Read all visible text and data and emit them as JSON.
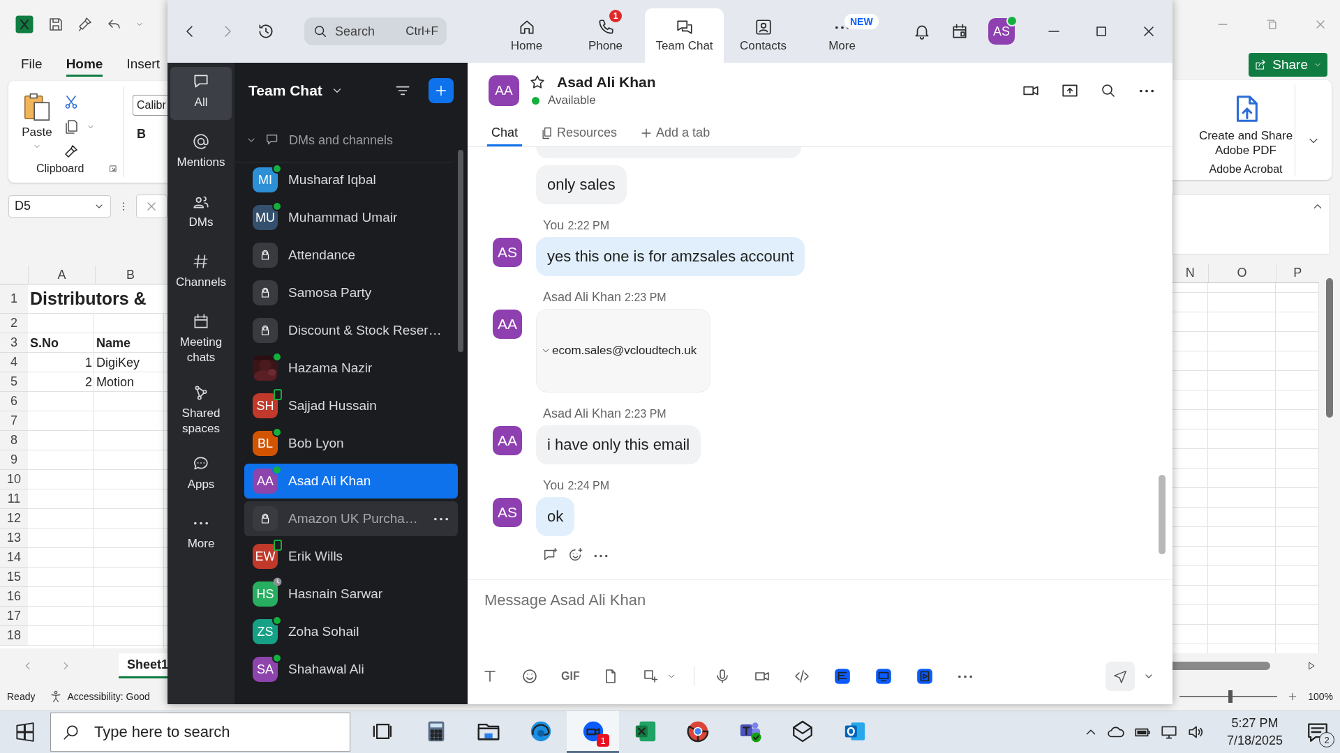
{
  "excel": {
    "ribbon_tabs": [
      {
        "label": "File",
        "selected": false
      },
      {
        "label": "Home",
        "selected": true
      },
      {
        "label": "Insert",
        "selected": false
      }
    ],
    "paste_label": "Paste",
    "clipboard_label": "Clipboard",
    "font_name": "Calibr",
    "bold_label": "B",
    "name_box": "D5",
    "left_columns": [
      "A",
      "B"
    ],
    "rows": [
      {
        "number": "1",
        "kind": "title",
        "text": "Distributors &"
      },
      {
        "number": "2",
        "kind": "plain"
      },
      {
        "number": "3",
        "kind": "header",
        "a": "S.No",
        "b": "Name"
      },
      {
        "number": "4",
        "kind": "plain",
        "a": "1",
        "b": "DigiKey"
      },
      {
        "number": "5",
        "kind": "plain",
        "a": "2",
        "b": "Motion"
      },
      {
        "number": "6",
        "kind": "plain"
      },
      {
        "number": "7",
        "kind": "plain"
      },
      {
        "number": "8",
        "kind": "plain"
      },
      {
        "number": "9",
        "kind": "plain"
      },
      {
        "number": "10",
        "kind": "plain"
      },
      {
        "number": "11",
        "kind": "plain"
      },
      {
        "number": "12",
        "kind": "plain"
      },
      {
        "number": "13",
        "kind": "plain"
      },
      {
        "number": "14",
        "kind": "plain"
      },
      {
        "number": "15",
        "kind": "plain"
      },
      {
        "number": "16",
        "kind": "plain"
      },
      {
        "number": "17",
        "kind": "plain"
      },
      {
        "number": "18",
        "kind": "plain"
      }
    ],
    "share_label": "Share",
    "acrobat_button": "Create and Share Adobe PDF",
    "acrobat_group": "Adobe Acrobat",
    "right_columns": [
      "N",
      "O",
      "P"
    ],
    "sheet_tab": "Sheet1",
    "status": "Ready",
    "accessibility": "Accessibility: Good",
    "zoom_slider": {
      "level": 0.52
    },
    "zoom_level": "100%"
  },
  "zoom": {
    "search": {
      "placeholder": "Search",
      "shortcut": "Ctrl+F"
    },
    "nav": [
      {
        "label": "Home",
        "kind": "home",
        "selected": false
      },
      {
        "label": "Phone",
        "kind": "phone",
        "selected": false,
        "badge": "1",
        "badge_new": false
      },
      {
        "label": "Team Chat",
        "kind": "chat",
        "selected": true
      },
      {
        "label": "Contacts",
        "kind": "contacts",
        "selected": false
      },
      {
        "label": "More",
        "kind": "more",
        "selected": false,
        "badge": "NEW",
        "badge_new": true
      }
    ],
    "user_avatar": {
      "initials": "AS",
      "online": true
    },
    "rail": [
      {
        "label": "All",
        "kind": "all",
        "selected": true
      },
      {
        "label": "Mentions",
        "kind": "mentions",
        "selected": false
      },
      {
        "label": "DMs",
        "kind": "dms",
        "selected": false
      },
      {
        "label": "Channels",
        "kind": "channels",
        "selected": false
      },
      {
        "label": "Meeting chats",
        "kind": "meetings",
        "selected": false
      },
      {
        "label": "Shared spaces",
        "kind": "spaces",
        "selected": false
      },
      {
        "label": "Apps",
        "kind": "apps",
        "selected": false
      },
      {
        "label": "More",
        "kind": "more",
        "selected": false
      }
    ],
    "list_title": "Team Chat",
    "section": {
      "label": "DMs and channels",
      "expanded": true
    },
    "chats": [
      {
        "name": "Musharaf Iqbal",
        "kind": "person",
        "initials": "MI",
        "color": "#2d8fd5",
        "online": true,
        "mobile": false,
        "away": false,
        "selected": false,
        "hovered": false
      },
      {
        "name": "Muhammad Umair",
        "kind": "person",
        "initials": "MU",
        "color": "#34506e",
        "online": true,
        "mobile": false,
        "away": false,
        "selected": false,
        "hovered": false
      },
      {
        "name": "Attendance",
        "kind": "channel",
        "online": false,
        "mobile": false,
        "away": false,
        "selected": false,
        "hovered": false
      },
      {
        "name": "Samosa Party",
        "kind": "channel",
        "online": false,
        "mobile": false,
        "away": false,
        "selected": false,
        "hovered": false
      },
      {
        "name": "Discount & Stock Reser…",
        "kind": "channel",
        "online": false,
        "mobile": false,
        "away": false,
        "selected": false,
        "hovered": false
      },
      {
        "name": "Hazama Nazir",
        "online": true,
        "mobile": false,
        "away": false,
        "selected": false,
        "hovered": false
      },
      {
        "name": "Sajjad Hussain",
        "kind": "person",
        "initials": "SH",
        "color": "#c0392b",
        "online": false,
        "mobile": true,
        "away": false,
        "selected": false,
        "hovered": false
      },
      {
        "name": "Bob Lyon",
        "kind": "person",
        "initials": "BL",
        "color": "#d35400",
        "online": true,
        "mobile": false,
        "away": false,
        "selected": false,
        "hovered": false
      },
      {
        "name": "Asad Ali Khan",
        "kind": "person",
        "initials": "AA",
        "color": "#8e44ad",
        "online": true,
        "mobile": false,
        "away": false,
        "selected": true,
        "hovered": false
      },
      {
        "name": "Amazon UK Purcha…",
        "kind": "channel",
        "online": false,
        "mobile": false,
        "away": false,
        "selected": false,
        "hovered": true
      },
      {
        "name": "Erik Wills",
        "kind": "person",
        "initials": "EW",
        "color": "#c0392b",
        "online": false,
        "mobile": true,
        "away": false,
        "selected": false,
        "hovered": false
      },
      {
        "name": "Hasnain Sarwar",
        "kind": "person",
        "initials": "HS",
        "color": "#27ae60",
        "online": false,
        "mobile": false,
        "away": true,
        "selected": false,
        "hovered": false
      },
      {
        "name": "Zoha Sohail",
        "kind": "person",
        "initials": "ZS",
        "color": "#16a085",
        "online": true,
        "mobile": false,
        "away": false,
        "selected": false,
        "hovered": false
      },
      {
        "name": "Shahawal Ali",
        "kind": "person",
        "initials": "SA",
        "color": "#8e44ad",
        "online": true,
        "mobile": false,
        "away": false,
        "selected": false,
        "hovered": false
      }
    ],
    "chat_header": {
      "initials": "AA",
      "name": "Asad Ali Khan",
      "status": "Available",
      "starred": false
    },
    "tabs": [
      {
        "label": "Chat",
        "kind": "chat",
        "selected": true
      },
      {
        "label": "Resources",
        "kind": "resources",
        "selected": false
      },
      {
        "label": "Add a tab",
        "kind": "add",
        "selected": false
      }
    ],
    "messages": [
      {
        "kind": "fragment",
        "mine": false
      },
      {
        "kind": "text",
        "text": "only sales",
        "mine": false,
        "show_actions": false
      },
      {
        "kind": "text",
        "sender": "You",
        "time": "2:22 PM",
        "initials": "AS",
        "text": "yes this one is for amzsales account",
        "mine": true,
        "show_actions": false
      },
      {
        "kind": "email",
        "sender": "Asad Ali Khan",
        "time": "2:23 PM",
        "initials": "AA",
        "text": "ecom.sales@vcloudtech.uk",
        "mine": false,
        "show_actions": false
      },
      {
        "kind": "text",
        "sender": "Asad Ali Khan",
        "time": "2:23 PM",
        "initials": "AA",
        "text": "i have only this email",
        "mine": false,
        "show_actions": false
      },
      {
        "kind": "text",
        "sender": "You",
        "time": "2:24 PM",
        "initials": "AS",
        "text": "ok",
        "mine": true,
        "show_actions": true
      }
    ],
    "composer": {
      "placeholder": "Message Asad Ali Khan",
      "tools": [
        {
          "kind": "text"
        },
        {
          "kind": "emoji"
        },
        {
          "kind": "gif",
          "label": "GIF"
        },
        {
          "kind": "file"
        },
        {
          "kind": "screenshot"
        },
        {
          "kind": "caret"
        },
        {
          "kind": "divider"
        },
        {
          "kind": "mic"
        },
        {
          "kind": "video"
        },
        {
          "kind": "code"
        },
        {
          "kind": "docs"
        },
        {
          "kind": "whiteboard"
        },
        {
          "kind": "clips"
        },
        {
          "kind": "more"
        }
      ]
    }
  },
  "taskbar": {
    "search_placeholder": "Type here to search",
    "apps": [
      {
        "kind": "taskview",
        "active": false
      },
      {
        "kind": "calculator",
        "active": false
      },
      {
        "kind": "explorer",
        "active": false
      },
      {
        "kind": "edge",
        "active": false
      },
      {
        "kind": "zoom",
        "active": true,
        "badge": "1"
      },
      {
        "kind": "excel",
        "active": false
      },
      {
        "kind": "chrome",
        "active": false
      },
      {
        "kind": "teams",
        "active": false
      },
      {
        "kind": "app",
        "active": false
      },
      {
        "kind": "outlook",
        "active": false
      }
    ],
    "time": "5:27 PM",
    "date": "7/18/2025",
    "notifications": "2"
  }
}
